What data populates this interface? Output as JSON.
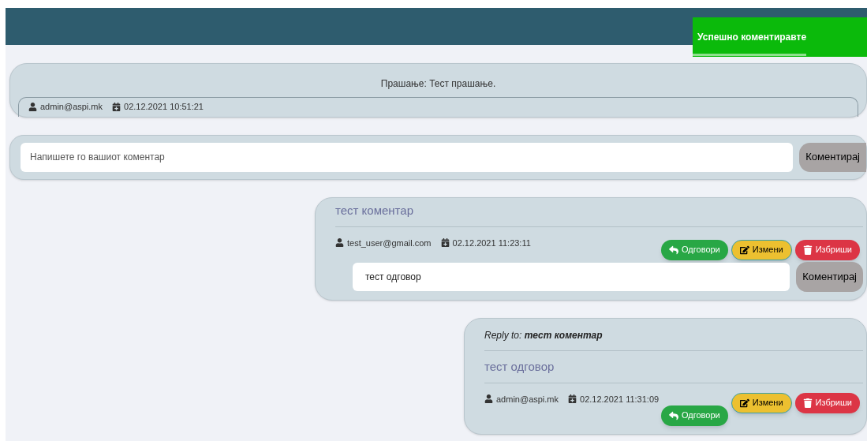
{
  "toast": {
    "message": "Успешно коментиравте",
    "level": 0.65
  },
  "question": {
    "text": "Прашање: Тест прашање.",
    "author": "admin@aspi.mk",
    "date": "02.12.2021 10:51:21"
  },
  "comment_form": {
    "placeholder": "Напишете го вашиот коментар",
    "button": "Коментирај"
  },
  "comments": [
    {
      "title": "тест коментар",
      "author": "test_user@gmail.com",
      "date": "02.12.2021 11:23:11",
      "actions": [
        {
          "kind": "reply",
          "label": "Одговори"
        },
        {
          "kind": "edit",
          "label": "Измени"
        },
        {
          "kind": "delete",
          "label": "Избриши"
        }
      ],
      "reply_form": {
        "value": "тест одговор",
        "button": "Коментирај"
      }
    },
    {
      "reply_to": "Reply to: **тест коментар**",
      "title": "тест одговор",
      "author": "admin@aspi.mk",
      "date": "02.12.2021 11:31:09",
      "actions": [
        {
          "kind": "reply",
          "label": "Одговори"
        },
        {
          "kind": "edit",
          "label": "Измени"
        },
        {
          "kind": "delete",
          "label": "Избриши"
        }
      ]
    }
  ]
}
